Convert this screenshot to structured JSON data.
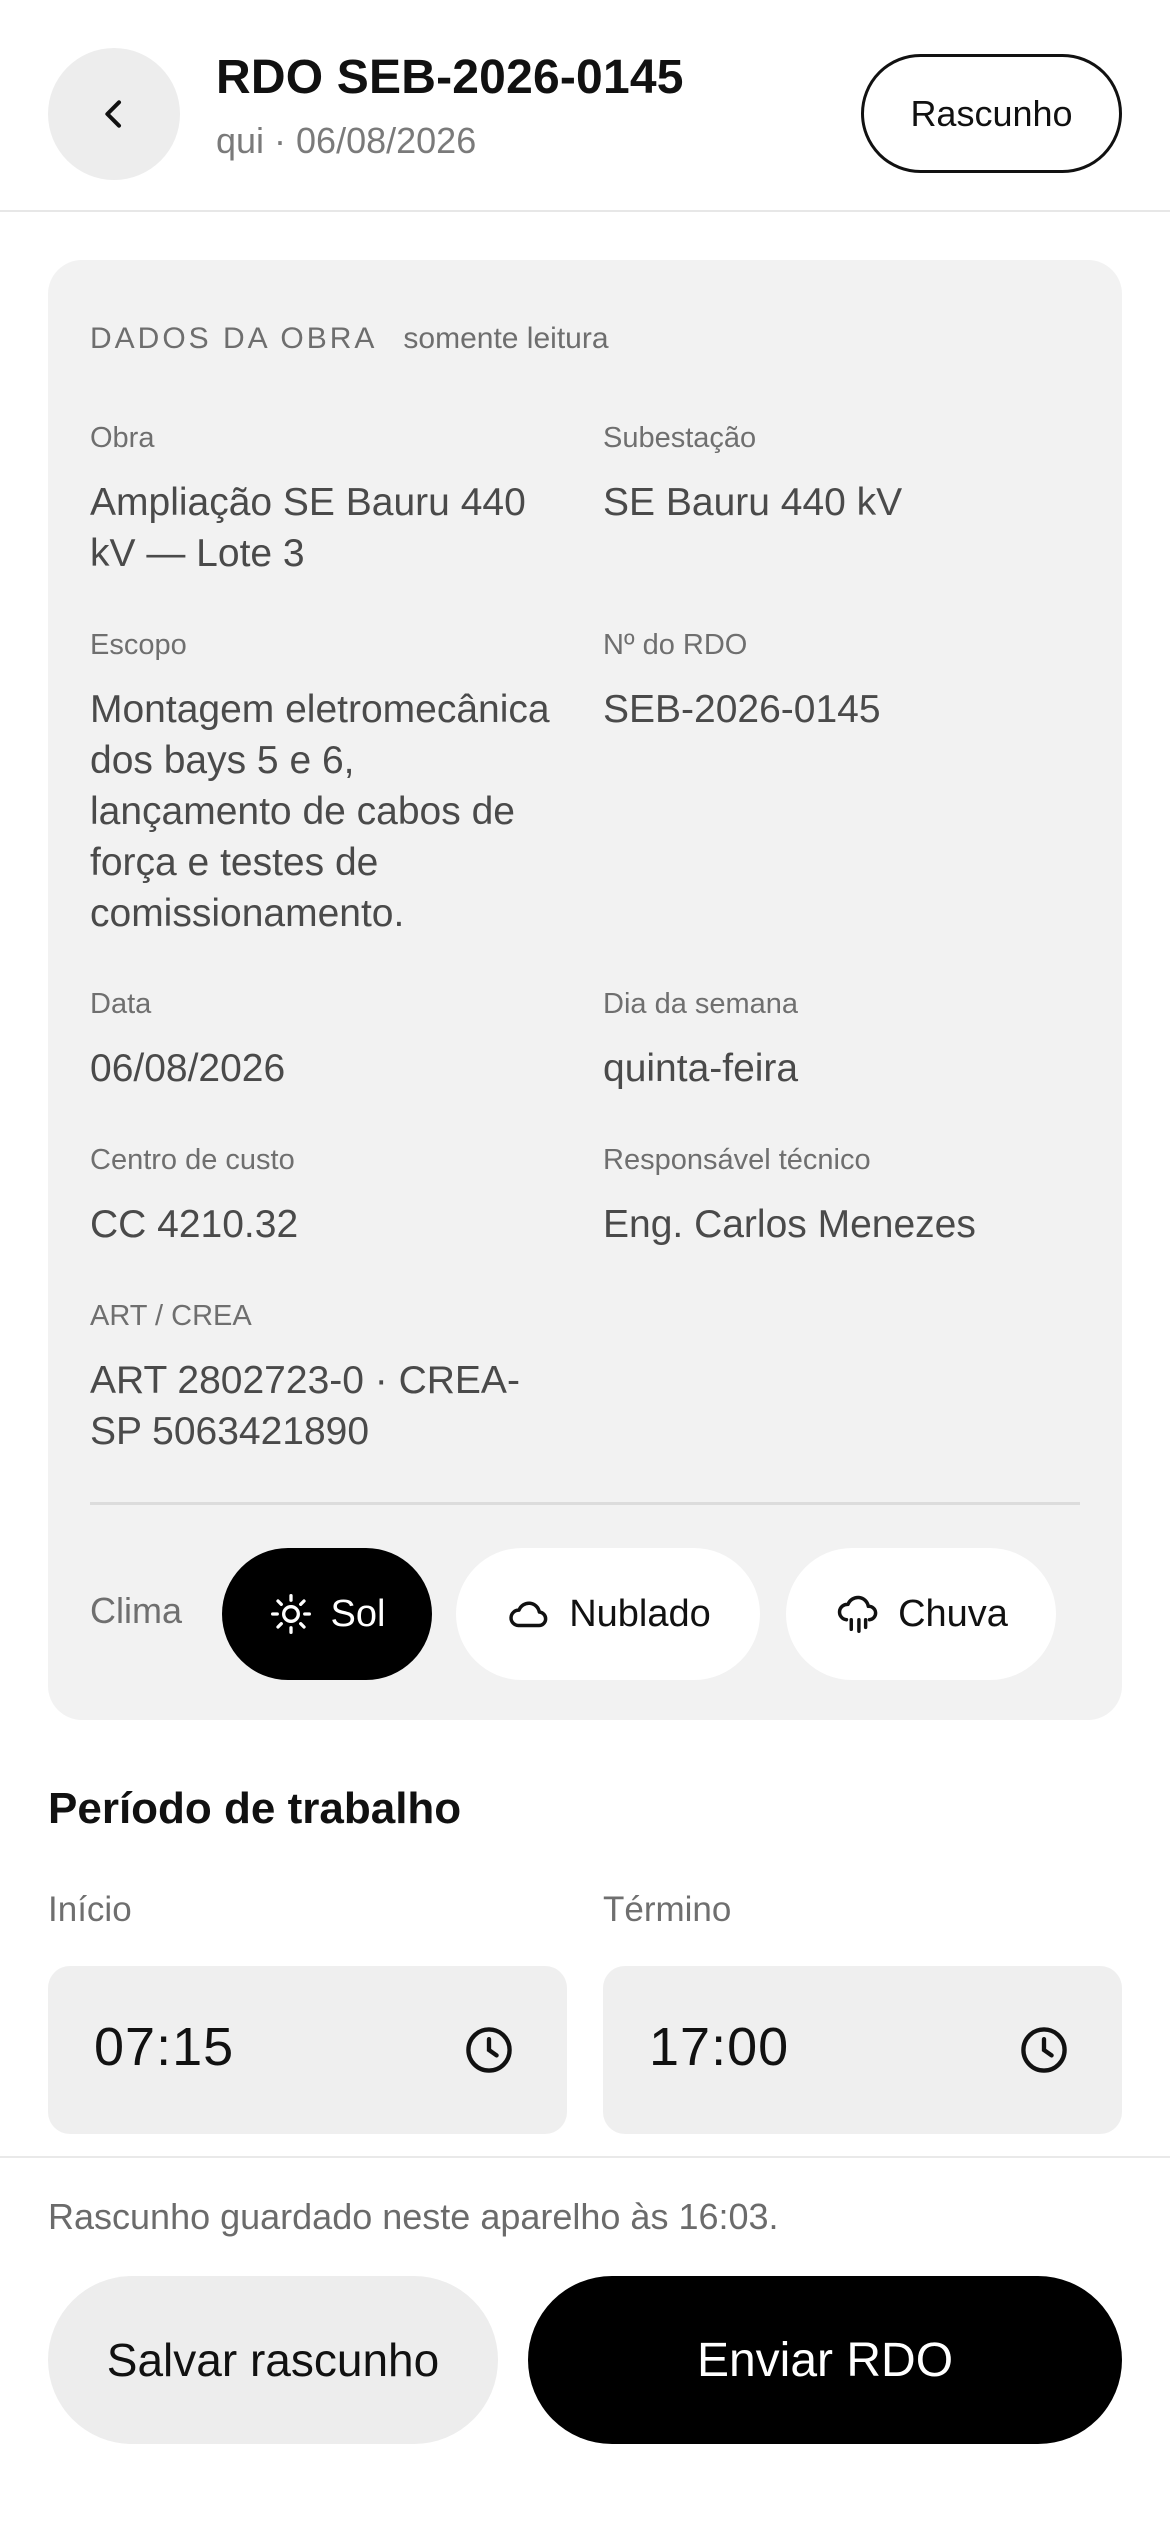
{
  "header": {
    "title": "RDO SEB-2026-0145",
    "subtitle": "qui · 06/08/2026",
    "status": "Rascunho",
    "back_icon": "chevron-left-icon"
  },
  "card": {
    "title": "DADOS DA OBRA",
    "note": "somente leitura",
    "fields": {
      "obra": {
        "label": "Obra",
        "value": "Ampliação SE Bauru 440 kV — Lote 3"
      },
      "subestacao": {
        "label": "Subestação",
        "value": "SE Bauru 440 kV"
      },
      "escopo": {
        "label": "Escopo",
        "value": "Montagem eletromecânica dos bays 5 e 6, lançamento de cabos de força e testes de comissionamento."
      },
      "numero": {
        "label": "Nº do RDO",
        "value": "SEB-2026-0145"
      },
      "data": {
        "label": "Data",
        "value": "06/08/2026"
      },
      "dia": {
        "label": "Dia da semana",
        "value": "quinta-feira"
      },
      "centro": {
        "label": "Centro de custo",
        "value": "CC 4210.32"
      },
      "responsavel": {
        "label": "Responsável técnico",
        "value": "Eng. Carlos Menezes"
      },
      "art": {
        "label": "ART / CREA",
        "value": "ART 2802723-0 · CREA-SP 5063421890"
      }
    },
    "clima": {
      "label": "Clima",
      "selected": "Sol",
      "options": [
        {
          "label": "Sol",
          "icon": "sun-icon"
        },
        {
          "label": "Nublado",
          "icon": "cloud-icon"
        },
        {
          "label": "Chuva",
          "icon": "cloud-rain-icon"
        }
      ]
    }
  },
  "periodo": {
    "title": "Período de trabalho",
    "inicio": {
      "label": "Início",
      "value": "07:15",
      "icon": "clock-icon"
    },
    "termino": {
      "label": "Término",
      "value": "17:00",
      "icon": "clock-icon"
    }
  },
  "footer": {
    "note": "Rascunho guardado neste aparelho às 16:03.",
    "save_label": "Salvar rascunho",
    "send_label": "Enviar RDO"
  },
  "colors": {
    "accent": "#000000",
    "card_bg": "#f2f2f2",
    "input_bg": "#efefef"
  }
}
